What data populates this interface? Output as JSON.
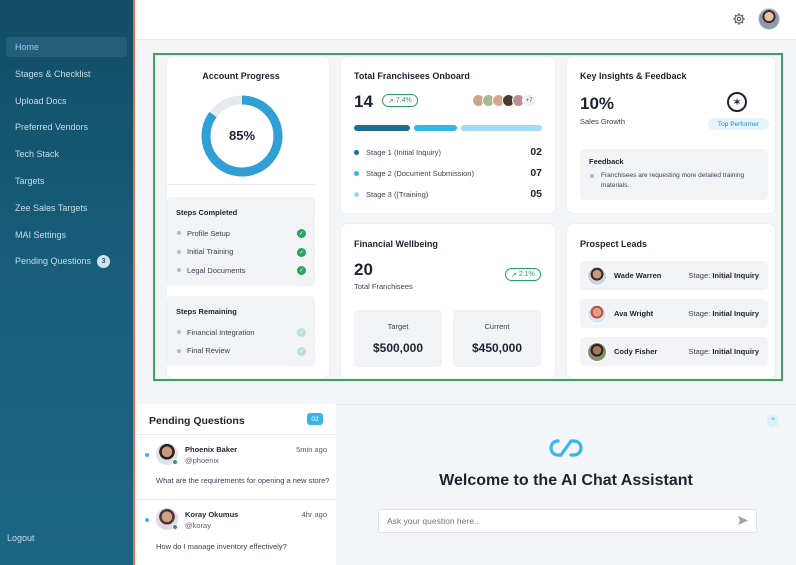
{
  "sidebar": {
    "items": [
      {
        "label": "Home"
      },
      {
        "label": "Stages & Checklist"
      },
      {
        "label": "Upload Docs"
      },
      {
        "label": "Preferred Vendors"
      },
      {
        "label": "Tech Stack"
      },
      {
        "label": "Targets"
      },
      {
        "label": "Zee Sales Targets"
      },
      {
        "label": "MAI Settings"
      },
      {
        "label": "Pending Questions",
        "badge": "3"
      }
    ],
    "logout": "Logout"
  },
  "topbar": {
    "settings_icon": "gear-icon",
    "avatar_icon": "user-avatar"
  },
  "account_progress": {
    "title": "Account Progress",
    "percent": "85%",
    "percent_value": 0.85,
    "completed_title": "Steps Completed",
    "completed": [
      {
        "label": "Profile Setup"
      },
      {
        "label": "Initial Training"
      },
      {
        "label": "Legal Documents"
      }
    ],
    "remaining_title": "Steps Remaining",
    "remaining": [
      {
        "label": "Financial Integration"
      },
      {
        "label": "Final Review"
      }
    ]
  },
  "onboard": {
    "title": "Total Franchisees Onboard",
    "value": "14",
    "change": "7.4%",
    "more_avatars": "+7",
    "stages": [
      {
        "label": "Stage 1 (Initial Inquiry)",
        "value": "02",
        "color": "#1a6f96"
      },
      {
        "label": "Stage 2 (Document Submission)",
        "value": "07",
        "color": "#33b7ec"
      },
      {
        "label": "Stage 3 ((Training)",
        "value": "05",
        "color": "#9fdcf5"
      }
    ]
  },
  "insights": {
    "title": "Key Insights & Feedback",
    "value": "10%",
    "label": "Sales Growth",
    "badge": "Top Performer",
    "feedback_title": "Feedback",
    "feedback_text": "Franchisees are requesting more detailed training materials."
  },
  "wellbeing": {
    "title": "Financial Wellbeing",
    "value": "20",
    "change": "2.1%",
    "label": "Total Franchisees",
    "target_label": "Target",
    "target_value": "$500,000",
    "current_label": "Current",
    "current_value": "$450,000"
  },
  "leads": {
    "title": "Prospect Leads",
    "stage_prefix": "Stage:",
    "items": [
      {
        "name": "Wade Warren",
        "stage": "Initial Inquiry"
      },
      {
        "name": "Ava Wright",
        "stage": "Initial Inquiry"
      },
      {
        "name": "Cody Fisher",
        "stage": "Initial Inquiry"
      }
    ]
  },
  "pending": {
    "title": "Pending Questions",
    "count": "02",
    "questions": [
      {
        "name": "Phoenix Baker",
        "handle": "@phoenix",
        "time": "5min ago",
        "text": "What are the requirements for opening a new store?"
      },
      {
        "name": "Koray Okumus",
        "handle": "@koray",
        "time": "4hr ago",
        "text": "How do I manage inventory effectively?"
      }
    ]
  },
  "chat": {
    "welcome": "Welcome to the AI Chat Assistant",
    "placeholder": "Ask your question here..",
    "brand_color": "#3ab4ec"
  }
}
